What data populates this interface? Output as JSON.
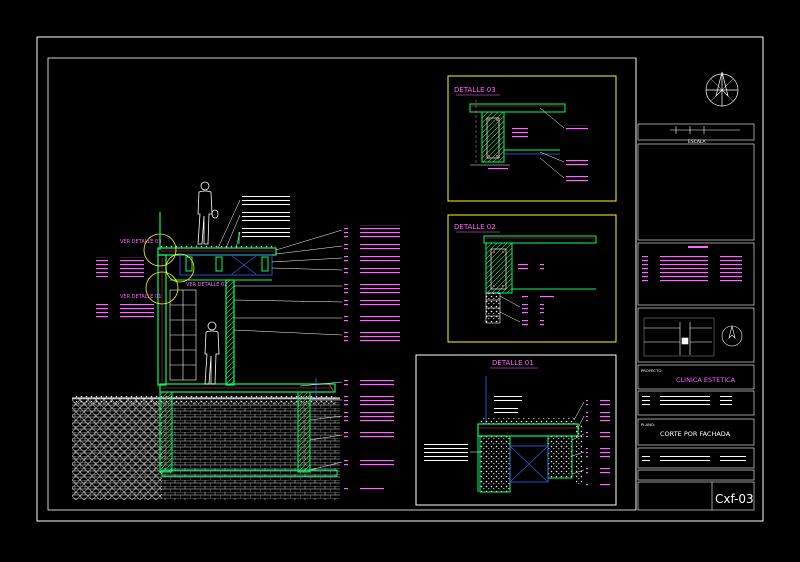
{
  "colors": {
    "background": "#000000",
    "frame": "#ffffff",
    "detail_frame": "#ffff00",
    "title": "#ff66ff",
    "annotation": "#ff66ff",
    "structure": "#00ff66",
    "rebar": "#ff3333",
    "dimension": "#3366ff",
    "figure": "#ffffff"
  },
  "details": {
    "d03": "DETALLE 03",
    "d02": "DETALLE 02",
    "d01": "DETALLE 01"
  },
  "section_labels": {
    "ver_detalle_a": "VER DETALLE 03",
    "ver_detalle_b": "VER DETALLE 02",
    "ver_detalle_c": "VER DETALLE 01"
  },
  "title_block": {
    "escala_header": "ESCALA",
    "proyecto_label": "PROYECTO:",
    "proyecto_value": "CLINICA ESTETICA",
    "plano_label": "PLANO:",
    "plano_value": "CORTE POR FACHADA",
    "sheet_code": "Cxf-03"
  },
  "icons": [
    "north-arrow-icon",
    "location-map-icon",
    "human-figure-icon"
  ]
}
